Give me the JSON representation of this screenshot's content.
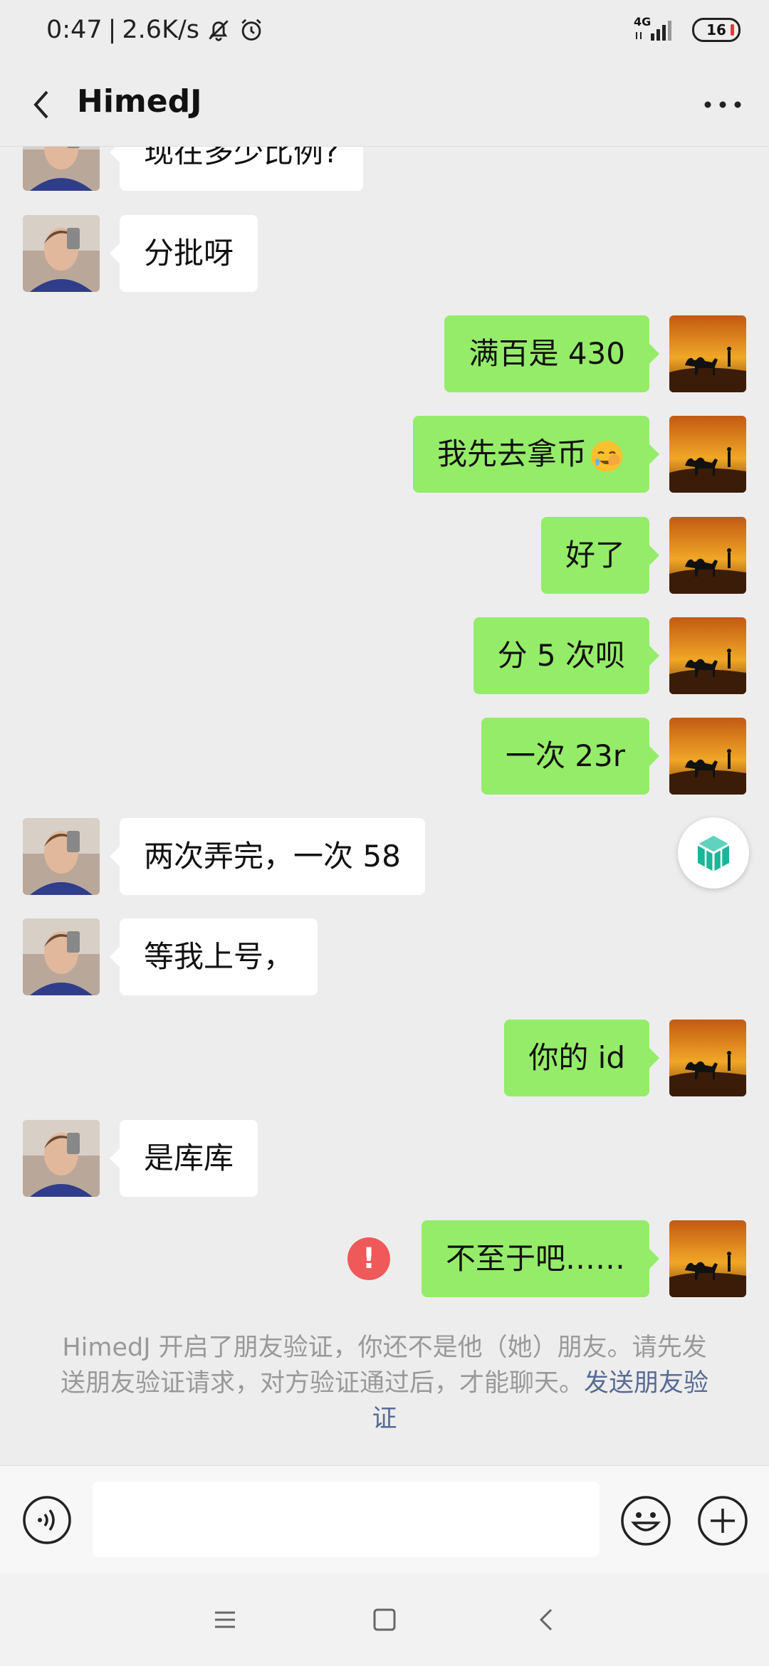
{
  "status_bar": {
    "time": "0:47",
    "speed": "2.6K/s",
    "network": "4G",
    "battery": "16"
  },
  "header": {
    "title": "HimedJ"
  },
  "messages": [
    {
      "side": "left",
      "text": "现在多少比例?"
    },
    {
      "side": "left",
      "text": "分批呀"
    },
    {
      "side": "right",
      "text": "满百是 430"
    },
    {
      "side": "right",
      "text": "我先去拿币"
    },
    {
      "side": "right",
      "text": "好了"
    },
    {
      "side": "right",
      "text": "分 5 次呗"
    },
    {
      "side": "right",
      "text": "一次 23r"
    },
    {
      "side": "left",
      "text": "两次弄完，一次 58"
    },
    {
      "side": "left",
      "text": "等我上号，"
    },
    {
      "side": "right",
      "text": "你的 id"
    },
    {
      "side": "left",
      "text": "是库库"
    },
    {
      "side": "right",
      "text": "不至于吧……",
      "failed": true
    }
  ],
  "notice": {
    "text": "HimedJ 开启了朋友验证，你还不是他（她）朋友。请先发送朋友验证请求，对方验证通过后，才能聊天。",
    "link": "发送朋友验证"
  },
  "colors": {
    "background": "#ededed",
    "bubble_self": "#95ec69",
    "bubble_other": "#ffffff",
    "link": "#576b95",
    "error": "#f0595a"
  }
}
